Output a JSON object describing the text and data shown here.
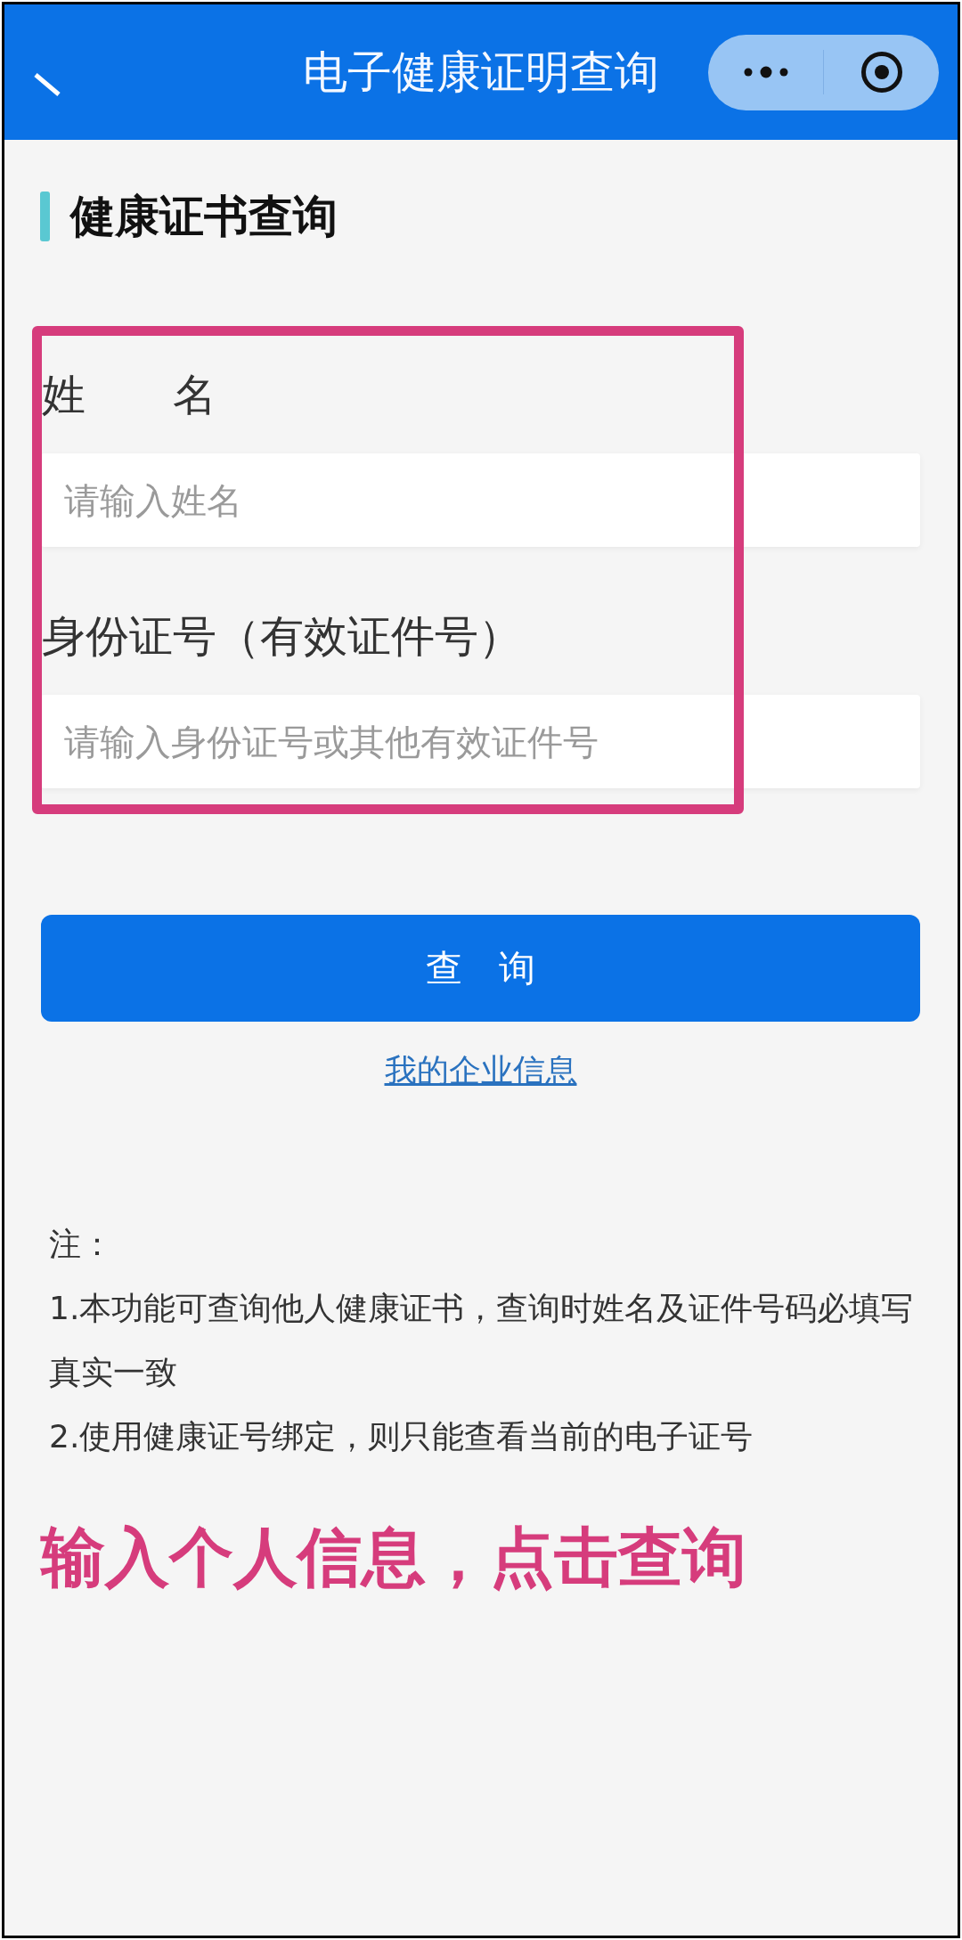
{
  "nav_bar": {
    "title": "电子健康证明查询"
  },
  "section": {
    "title": "健康证书查询"
  },
  "form": {
    "fields": [
      {
        "label": "姓　　名",
        "placeholder": "请输入姓名"
      },
      {
        "label": "身份证号（有效证件号）",
        "placeholder": "请输入身份证号或其他有效证件号"
      }
    ],
    "submit_button": "查　询",
    "link": "我的企业信息"
  },
  "notes": {
    "heading": "注：",
    "items": [
      "1.本功能可查询他人健康证书，查询时姓名及证件号码必填写真实一致",
      "2.使用健康证号绑定，则只能查看当前的电子证号"
    ]
  },
  "annotation": {
    "caption": "输入个人信息，点击查询"
  }
}
